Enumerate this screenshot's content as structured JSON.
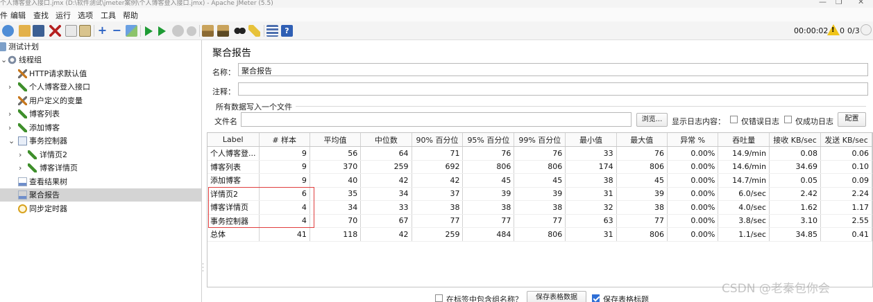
{
  "window": {
    "title": "个人博客登入接口.jmx (D:\\软件测试\\jmeter案例\\个人博客登入接口.jmx) - Apache JMeter (5.5)"
  },
  "menu": [
    "件",
    "编辑",
    "查找",
    "运行",
    "选项",
    "工具",
    "帮助"
  ],
  "toolbar": {
    "icons": [
      "templates-icon",
      "open-icon",
      "save-icon",
      "cut-icon",
      "copy-icon",
      "paste-icon",
      "expand-icon",
      "collapse-icon",
      "toggle-icon",
      "start-icon",
      "start-no-pause-icon",
      "stop-icon",
      "shutdown-icon",
      "clear-icon",
      "clear-all-icon",
      "search-icon",
      "reset-search-icon",
      "function-helper-icon",
      "help-icon"
    ],
    "timer": "00:00:02",
    "warnings": "0",
    "threads": "0/3"
  },
  "tree": [
    {
      "label": "测试计划",
      "icon": "test-plan-icon"
    },
    {
      "label": "线程组",
      "icon": "thread-group-icon"
    },
    {
      "label": "HTTP请求默认值",
      "icon": "config-icon"
    },
    {
      "label": "个人博客登入接口",
      "icon": "sampler-icon"
    },
    {
      "label": "用户定义的变量",
      "icon": "config-icon"
    },
    {
      "label": "博客列表",
      "icon": "sampler-icon"
    },
    {
      "label": "添加博客",
      "icon": "sampler-icon"
    },
    {
      "label": "事务控制器",
      "icon": "controller-icon"
    },
    {
      "label": "详情页2",
      "icon": "sampler-icon"
    },
    {
      "label": "博客详情页",
      "icon": "sampler-icon"
    },
    {
      "label": "查看结果树",
      "icon": "listener-icon"
    },
    {
      "label": "聚合报告",
      "icon": "listener-icon"
    },
    {
      "label": "同步定时器",
      "icon": "timer-icon"
    }
  ],
  "panel": {
    "title": "聚合报告",
    "name_label": "名称：",
    "name_value": "聚合报告",
    "comment_label": "注释：",
    "comment_value": "",
    "group_title": "所有数据写入一个文件",
    "file_label": "文件名",
    "file_value": "",
    "browse_label": "浏览...",
    "log_label": "显示日志内容：",
    "errors_only_label": "仅错误日志",
    "success_only_label": "仅成功日志",
    "configure_label": "配置"
  },
  "table": {
    "headers": [
      "Label",
      "# 样本",
      "平均值",
      "中位数",
      "90% 百分位",
      "95% 百分位",
      "99% 百分位",
      "最小值",
      "最大值",
      "异常 %",
      "吞吐量",
      "接收 KB/sec",
      "发送 KB/sec"
    ],
    "rows": [
      [
        "个人博客登...",
        "9",
        "56",
        "64",
        "71",
        "76",
        "76",
        "33",
        "76",
        "0.00%",
        "14.9/min",
        "0.08",
        "0.06"
      ],
      [
        "博客列表",
        "9",
        "370",
        "259",
        "692",
        "806",
        "806",
        "174",
        "806",
        "0.00%",
        "14.6/min",
        "34.69",
        "0.10"
      ],
      [
        "添加博客",
        "9",
        "40",
        "42",
        "42",
        "45",
        "45",
        "38",
        "45",
        "0.00%",
        "14.7/min",
        "0.05",
        "0.09"
      ],
      [
        "详情页2",
        "6",
        "35",
        "34",
        "37",
        "39",
        "39",
        "31",
        "39",
        "0.00%",
        "6.0/sec",
        "2.42",
        "2.24"
      ],
      [
        "博客详情页",
        "4",
        "34",
        "33",
        "38",
        "38",
        "38",
        "32",
        "38",
        "0.00%",
        "4.0/sec",
        "1.62",
        "1.17"
      ],
      [
        "事务控制器",
        "4",
        "70",
        "67",
        "77",
        "77",
        "77",
        "63",
        "77",
        "0.00%",
        "3.8/sec",
        "3.10",
        "2.55"
      ],
      [
        "总体",
        "41",
        "118",
        "42",
        "259",
        "484",
        "806",
        "31",
        "806",
        "0.00%",
        "1.1/sec",
        "34.85",
        "0.41"
      ]
    ]
  },
  "footer": {
    "group_name_label": "在标签中包含组名称？",
    "save_table_label": "保存表格数据",
    "save_header_label": "保存表格标题"
  },
  "watermark": "CSDN @老秦包你会",
  "colors": {
    "highlight": "#e03d3d",
    "selected_node": "#d4d4d4"
  }
}
